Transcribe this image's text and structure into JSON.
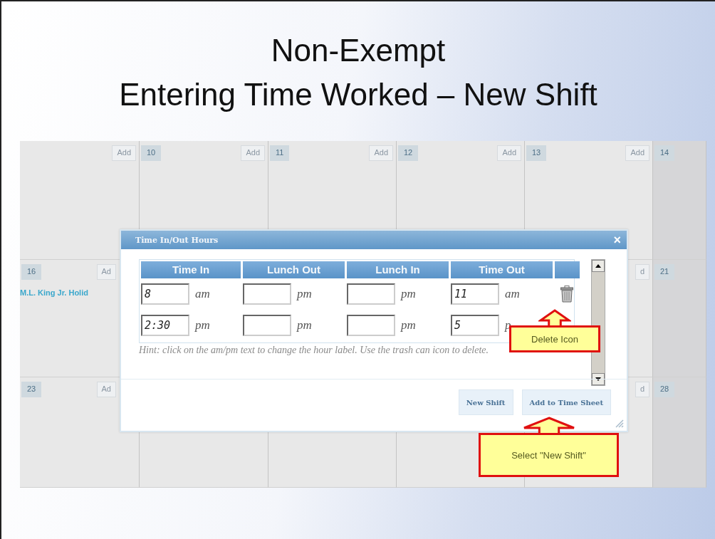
{
  "slide": {
    "title_lines": [
      "Non-Exempt",
      "Entering Time Worked – New Shift"
    ]
  },
  "calendar": {
    "rows": [
      {
        "cells": [
          {
            "add": "Add",
            "weekend": false
          },
          {
            "number": "10",
            "add": "Add",
            "weekend": false
          },
          {
            "number": "11",
            "add": "Add",
            "weekend": false
          },
          {
            "number": "12",
            "add": "Add",
            "weekend": false
          },
          {
            "number": "13",
            "add": "Add",
            "weekend": false
          },
          {
            "number": "14",
            "weekend": true
          }
        ]
      },
      {
        "cells": [
          {
            "number": "16",
            "add": "Ad",
            "event": "M.L. King Jr. Holid",
            "weekend": false
          },
          {},
          {},
          {},
          {
            "add": "d",
            "weekend": false
          },
          {
            "number": "21",
            "weekend": true
          }
        ]
      },
      {
        "cells": [
          {
            "number": "23",
            "add": "Ad",
            "weekend": false
          },
          {
            "weekend": false
          },
          {
            "weekend": false
          },
          {
            "weekend": false
          },
          {
            "add": "d",
            "weekend": false
          },
          {
            "number": "28",
            "weekend": true
          }
        ]
      }
    ]
  },
  "dialog": {
    "title": "Time In/Out Hours",
    "close": "×",
    "columns": [
      "Time In",
      "Lunch Out",
      "Lunch In",
      "Time Out"
    ],
    "rows": [
      {
        "entries": [
          {
            "value": "8",
            "period": "am"
          },
          {
            "period": "pm"
          },
          {
            "period": "pm"
          },
          {
            "value": "11",
            "period": "am"
          }
        ],
        "trash": true
      },
      {
        "entries": [
          {
            "value": "2:30",
            "period": "pm"
          },
          {
            "period": "pm"
          },
          {
            "period": "pm"
          },
          {
            "value": "5",
            "period": "p"
          }
        ]
      }
    ],
    "hint": "Hint: click on the am/pm text to change the hour label. Use the trash can icon to delete.",
    "buttons": [
      "New Shift",
      "Add to Time Sheet"
    ]
  },
  "callouts": [
    {
      "text": "Delete Icon"
    },
    {
      "text": "Select \"New Shift\""
    }
  ]
}
